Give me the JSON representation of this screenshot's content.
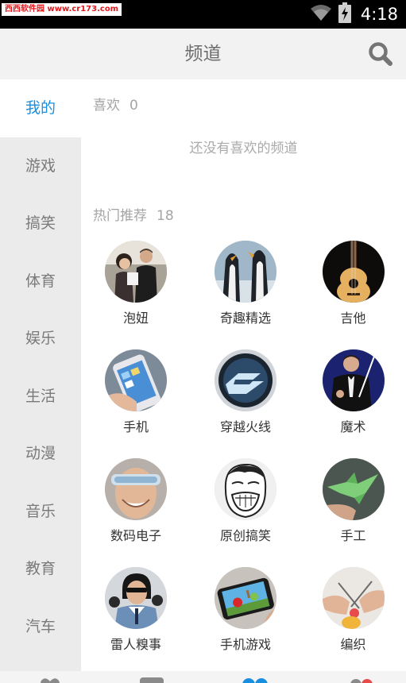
{
  "status_bar": {
    "watermark": "西西软件园 www.cr173.com",
    "time": "4:18",
    "icons": [
      "wifi-icon",
      "battery-charging-icon"
    ]
  },
  "header": {
    "title": "频道",
    "search_icon": "search-icon"
  },
  "sidebar": {
    "items": [
      {
        "label": "我的",
        "active": true
      },
      {
        "label": "游戏",
        "active": false
      },
      {
        "label": "搞笑",
        "active": false
      },
      {
        "label": "体育",
        "active": false
      },
      {
        "label": "娱乐",
        "active": false
      },
      {
        "label": "生活",
        "active": false
      },
      {
        "label": "动漫",
        "active": false
      },
      {
        "label": "音乐",
        "active": false
      },
      {
        "label": "教育",
        "active": false
      },
      {
        "label": "汽车",
        "active": false
      }
    ]
  },
  "favorites": {
    "title": "喜欢",
    "count": "0",
    "empty_text": "还没有喜欢的频道"
  },
  "hot": {
    "title": "热门推荐",
    "count": "18",
    "channels": [
      {
        "label": "泡妞",
        "icon": "couple-photo"
      },
      {
        "label": "奇趣精选",
        "icon": "penguins-photo"
      },
      {
        "label": "吉他",
        "icon": "guitar-photo"
      },
      {
        "label": "手机",
        "icon": "phone-photo"
      },
      {
        "label": "穿越火线",
        "icon": "crossfire-logo"
      },
      {
        "label": "魔术",
        "icon": "magician-photo"
      },
      {
        "label": "数码电子",
        "icon": "vr-glasses-photo"
      },
      {
        "label": "原创搞笑",
        "icon": "meme-face"
      },
      {
        "label": "手工",
        "icon": "paper-crane-photo"
      },
      {
        "label": "雷人糗事",
        "icon": "funny-student-photo"
      },
      {
        "label": "手机游戏",
        "icon": "angry-birds-photo"
      },
      {
        "label": "编织",
        "icon": "knitting-photo"
      }
    ]
  },
  "colors": {
    "accent": "#1a8fe0",
    "sidebar_bg": "#ebebeb",
    "header_bg": "#f2f2f2"
  }
}
